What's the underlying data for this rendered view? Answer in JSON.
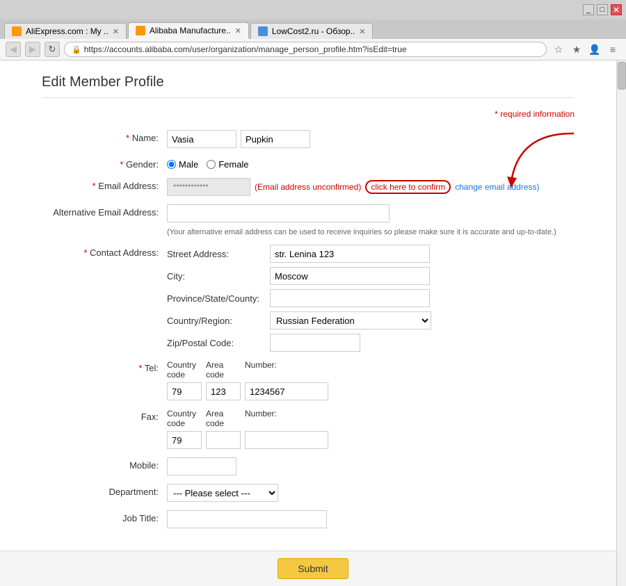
{
  "browser": {
    "tabs": [
      {
        "id": "tab1",
        "label": "AliExpress.com : My ..",
        "favicon": "ali",
        "active": false
      },
      {
        "id": "tab2",
        "label": "Alibaba Manufacture..",
        "favicon": "alibaba",
        "active": true
      },
      {
        "id": "tab3",
        "label": "LowCost2.ru - Обзор..",
        "favicon": "lc",
        "active": false
      }
    ],
    "url": "https://accounts.alibaba.com/user/organization/manage_person_profile.htm?isEdit=true",
    "nav_back": "◀",
    "nav_forward": "▶",
    "nav_refresh": "↻"
  },
  "page": {
    "title": "Edit Member Profile",
    "required_note": "* required information",
    "sections": {
      "name": {
        "label": "* Name:",
        "first_value": "Vasia",
        "last_value": "Pupkin"
      },
      "gender": {
        "label": "* Gender:",
        "options": [
          "Male",
          "Female"
        ],
        "selected": "Male"
      },
      "email": {
        "label": "* Email Address:",
        "masked_value": "••••••••••",
        "unconfirmed_text": "(Email address unconfirmed)",
        "confirm_link": "click here to confirm",
        "change_link": "change email address)"
      },
      "alt_email": {
        "label": "Alternative Email Address:",
        "hint": "(Your alternative email address can be used to receive inquiries so please make sure it is accurate and up-to-date.)"
      },
      "contact_address": {
        "label": "* Contact Address:",
        "street_label": "Street Address:",
        "street_value": "str. Lenina 123",
        "city_label": "City:",
        "city_value": "Moscow",
        "province_label": "Province/State/County:",
        "province_value": "",
        "country_label": "Country/Region:",
        "country_value": "Russian Federation",
        "zip_label": "Zip/Postal Code:",
        "zip_value": ""
      },
      "tel": {
        "label": "* Tel:",
        "country_code_label": "Country code",
        "area_code_label": "Area code",
        "number_label": "Number:",
        "country_code_value": "79",
        "area_code_value": "123",
        "number_value": "1234567"
      },
      "fax": {
        "label": "Fax:",
        "country_code_label": "Country code",
        "area_code_label": "Area code",
        "number_label": "Number:",
        "country_code_value": "79",
        "area_code_value": "",
        "number_value": ""
      },
      "mobile": {
        "label": "Mobile:",
        "value": ""
      },
      "department": {
        "label": "Department:",
        "placeholder": "--- Please select ---",
        "options": [
          "--- Please select ---"
        ]
      },
      "job_title": {
        "label": "Job Title:",
        "value": ""
      }
    },
    "submit_label": "Submit"
  }
}
